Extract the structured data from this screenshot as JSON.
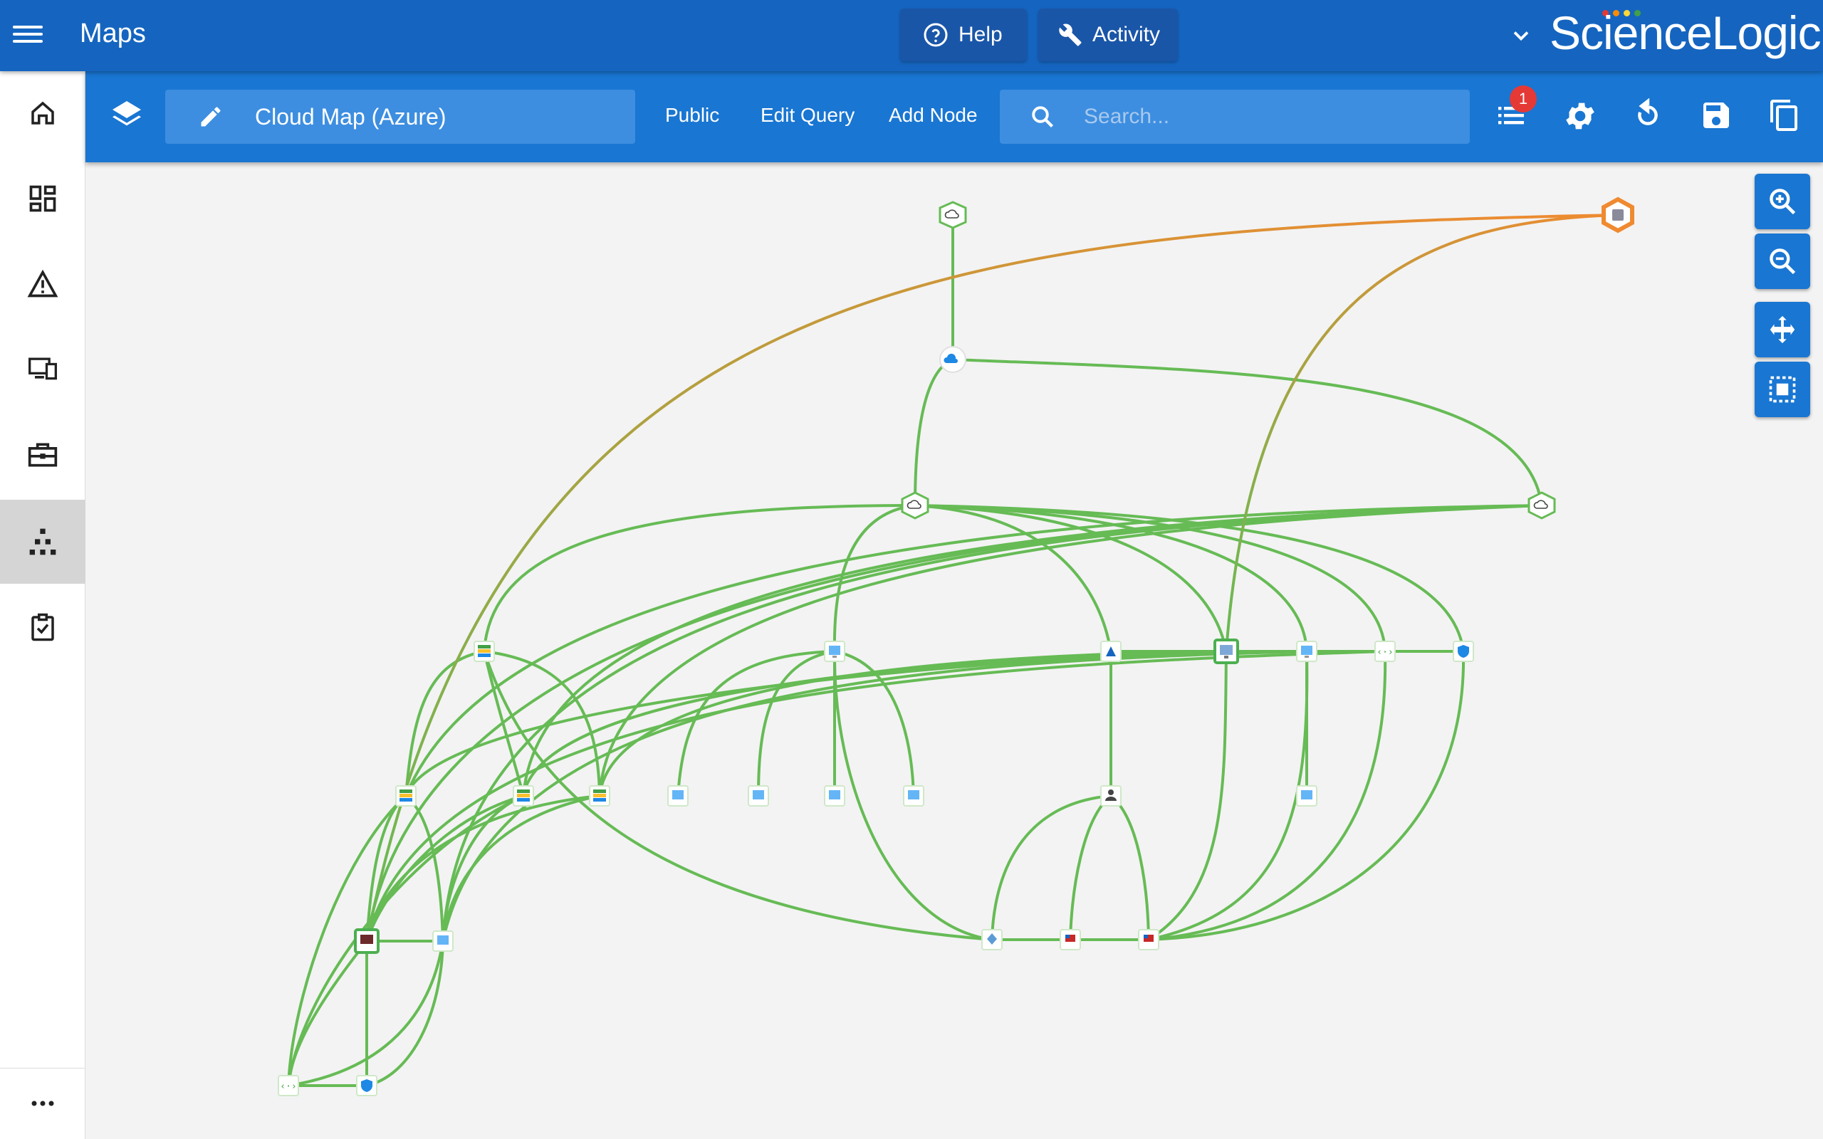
{
  "app": {
    "title": "Maps",
    "brand": "ScienceLogic"
  },
  "top_buttons": {
    "help": "Help",
    "activity": "Activity"
  },
  "toolbar": {
    "map_name": "Cloud Map (Azure)",
    "public_label": "Public",
    "edit_query_label": "Edit Query",
    "add_node_label": "Add Node",
    "search_placeholder": "Search...",
    "notification_count": "1"
  },
  "sidebar": {
    "items": [
      {
        "icon": "home-icon"
      },
      {
        "icon": "dashboard-icon"
      },
      {
        "icon": "alert-icon"
      },
      {
        "icon": "devices-icon"
      },
      {
        "icon": "briefcase-icon"
      },
      {
        "icon": "maps-icon",
        "active": true
      },
      {
        "icon": "checklist-icon"
      }
    ],
    "more_icon": "more-icon"
  },
  "colors": {
    "topbar": "#1565c0",
    "toolbar": "#1976d2",
    "edge_green": "#66bb55",
    "edge_orange": "#f08a30",
    "badge_red": "#e53935"
  },
  "map_nodes": [
    {
      "id": "n-cloud-top",
      "type": "cloud",
      "col": 12,
      "row": 0
    },
    {
      "id": "n-root-alert",
      "type": "database",
      "status": "major"
    },
    {
      "id": "n-cloud-service",
      "type": "cloud-service"
    },
    {
      "id": "n-region-left",
      "type": "cloud"
    },
    {
      "id": "n-region-right",
      "type": "cloud"
    },
    {
      "id": "n-storage-1",
      "type": "storage"
    },
    {
      "id": "n-vm-1",
      "type": "vm"
    },
    {
      "id": "n-azure-ad",
      "type": "azure"
    },
    {
      "id": "n-monitor",
      "type": "monitor"
    },
    {
      "id": "n-vm-2",
      "type": "vm"
    },
    {
      "id": "n-network-1",
      "type": "network"
    },
    {
      "id": "n-security-1",
      "type": "security"
    },
    {
      "id": "n-storage-2",
      "type": "storage"
    },
    {
      "id": "n-storage-3",
      "type": "storage"
    },
    {
      "id": "n-storage-4",
      "type": "storage"
    },
    {
      "id": "n-vm-3",
      "type": "vm"
    },
    {
      "id": "n-vm-4",
      "type": "vm"
    },
    {
      "id": "n-vm-5",
      "type": "vm"
    },
    {
      "id": "n-vm-6",
      "type": "vm"
    },
    {
      "id": "n-user",
      "type": "user"
    },
    {
      "id": "n-vm-7",
      "type": "vm"
    },
    {
      "id": "n-server",
      "type": "server"
    },
    {
      "id": "n-vm-8",
      "type": "vm"
    },
    {
      "id": "n-diamond",
      "type": "diamond"
    },
    {
      "id": "n-flag-1",
      "type": "flag"
    },
    {
      "id": "n-flag-2",
      "type": "flag"
    },
    {
      "id": "n-network-2",
      "type": "network"
    },
    {
      "id": "n-security-2",
      "type": "security"
    }
  ]
}
